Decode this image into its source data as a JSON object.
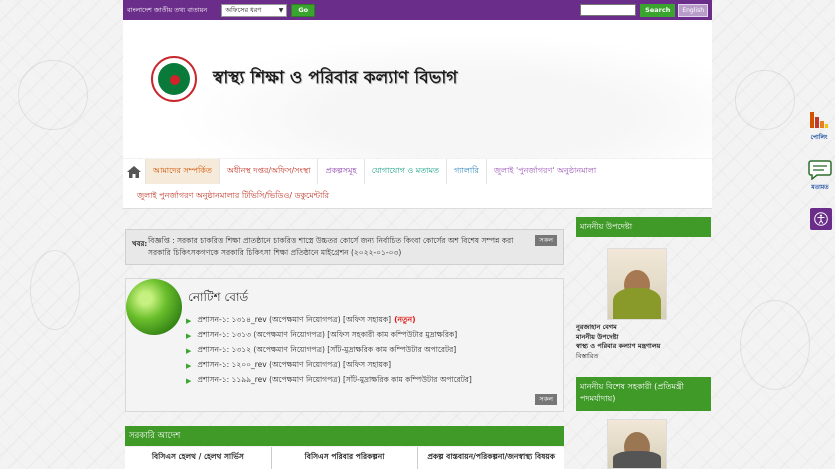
{
  "topbar": {
    "portal_label": "বাংলাদেশ জাতীয় তথ্য বাতায়ন",
    "office_select": "অফিসের ধরণ",
    "go_label": "Go",
    "search_label": "Search",
    "english_label": "English"
  },
  "banner": {
    "title": "স্বাস্থ্য শিক্ষা ও পরিবার কল্যাণ বিভাগ"
  },
  "nav": {
    "row1": [
      "আমাদের সম্পর্কিত",
      "অধীনস্থ দপ্তর/অফিস/সংস্থা",
      "প্রকল্পসমূহ",
      "যোগাযোগ ও মতামত",
      "গ্যালারি",
      "জুলাই 'পুনর্জাগরণ' অনুষ্ঠানমালা"
    ],
    "row2": [
      "জুলাই পুনর্জাগরণ অনুষ্ঠানমালার টিভিসি/ভিডিও/ ডকুমেন্টারি"
    ]
  },
  "news": {
    "label": "খবর:",
    "text": "বিজ্ঞপ্তি : সরকার চাকরিত্ত শিক্ষা প্রাতষ্ঠানে চাকরিত্ত শাস্ত্রে উচ্চতর কোর্সে জন্য নির্বাচিত কিংবা কোর্সের অশ বিশেষ সম্পন্ন করা সরকারি চিকিৎসকগণকে সরকারি চিকিৎসা শিক্ষা প্রতিষ্ঠানে মাইগ্রেশন (২০২২-০১-০৩)",
    "all_label": "সকল"
  },
  "notice_board": {
    "title": "নোটিশ বোর্ড",
    "items": [
      {
        "text": "প্রশাসন-১: ১৩১৪_rev (অপেক্ষমাণ নিয়োগপত্র) [অফিস সহায়ক]",
        "tag": "(নতুন)"
      },
      {
        "text": "প্রশাসন-১: ১৩১৩ (অপেক্ষমাণ নিয়োগপত্র) [অফিস সহকারী কাম কম্পিউটার মুদ্রাক্ষরিক]",
        "tag": ""
      },
      {
        "text": "প্রশাসন-১: ১৩১২ (অপেক্ষমাণ নিয়োগপত্র) [সাঁট-মুদ্রাক্ষরিক কাম কম্পিউটার অপারেটর]",
        "tag": ""
      },
      {
        "text": "প্রশাসন-১: ১২০০_rev (অপেক্ষমাণ নিয়োগপত্র) [অফিস সহায়ক]",
        "tag": ""
      },
      {
        "text": "প্রশাসন-১: ১১৯৯_rev (অপেক্ষমাণ নিয়োগপত্র) [সাঁট-মুদ্রাক্ষরিক কাম কম্পিউটার অপারেটর]",
        "tag": ""
      }
    ],
    "all_label": "সকল"
  },
  "gov_orders": {
    "title": "সরকারি আদেশ",
    "columns": [
      "বিসিএস হেলথ / হেলথ সার্ভিস",
      "বিসিএস পরিবার পরিকল্পনা",
      "প্রকল্প বাস্তবায়ন/পরিকল্পনা/জনস্বাস্থ্য বিষয়ক"
    ]
  },
  "sidebar": {
    "adviser_head": "মাননীয় উপদেষ্টা",
    "adviser_name": "নুরজাহান বেগম",
    "adviser_title": "মাননীয় উপদেষ্টা",
    "adviser_ministry": "স্বাস্থ্য ও পরিবার কল্যাণ মন্ত্রণালয়",
    "adviser_more": "বিস্তারিত",
    "assistant_head": "মাননীয় বিশেষ সহকারী (প্রতিমন্ত্রী পদমর্যাদায়)"
  },
  "float": {
    "polling": "পোলিং",
    "opinion": "মতামত"
  }
}
